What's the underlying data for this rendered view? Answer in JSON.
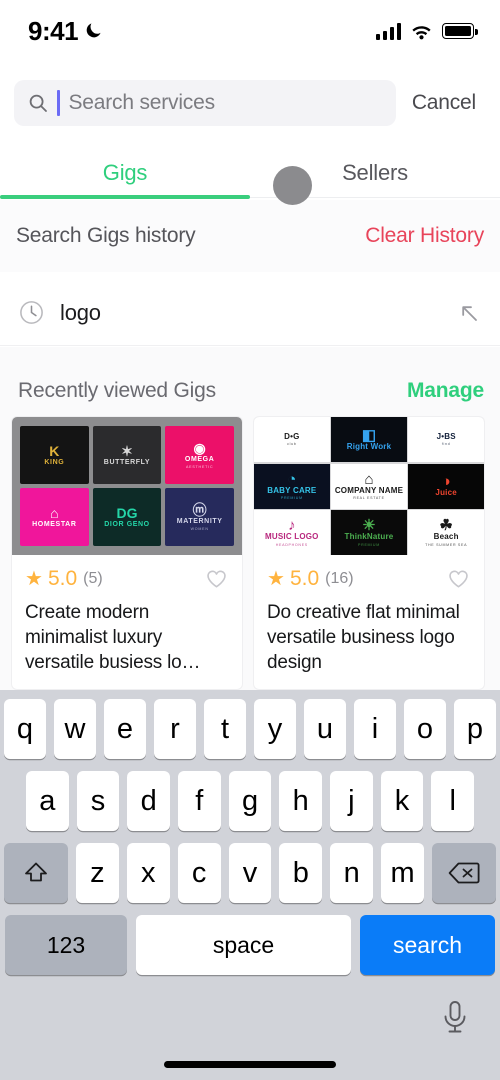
{
  "status_bar": {
    "time": "9:41",
    "dnd_icon": "crescent-moon-icon",
    "signal_icon": "cellular-signal-icon",
    "wifi_icon": "wifi-icon",
    "battery_icon": "battery-full-icon"
  },
  "search": {
    "placeholder": "Search services",
    "value": "",
    "cancel_label": "Cancel",
    "icon": "search-icon"
  },
  "tabs": [
    {
      "label": "Gigs",
      "active": true
    },
    {
      "label": "Sellers",
      "active": false
    }
  ],
  "history": {
    "section_title": "Search Gigs history",
    "clear_label": "Clear History",
    "items": [
      {
        "text": "logo",
        "leading_icon": "clock-icon",
        "trailing_icon": "arrow-up-left-icon"
      }
    ]
  },
  "recent": {
    "title": "Recently viewed Gigs",
    "manage_label": "Manage",
    "cards": [
      {
        "rating": "5.0",
        "reviews": "(5)",
        "title": "Create modern minimalist luxury versatile busiess lo…",
        "favorited": false,
        "thumbnail_style": "grid-6",
        "tiles": [
          {
            "name": "KING",
            "sub": "",
            "mark": "K",
            "bg": "#141414",
            "fg": "#e0b23a"
          },
          {
            "name": "BUTTERFLY",
            "sub": "",
            "mark": "✶",
            "bg": "#2b2b2d",
            "fg": "#d8d8d8"
          },
          {
            "name": "OMEGA",
            "sub": "AESTHETIC",
            "mark": "◉",
            "bg": "#ec1069",
            "fg": "#ffffff"
          },
          {
            "name": "HOMESTAR",
            "sub": "",
            "mark": "⌂",
            "bg": "#f0169b",
            "fg": "#ffffff"
          },
          {
            "name": "DIOR GENO",
            "sub": "",
            "mark": "DG",
            "bg": "#0d2b27",
            "fg": "#24d6a8"
          },
          {
            "name": "MATERNITY",
            "sub": "WOMEN",
            "mark": "ⓜ",
            "bg": "#262a5c",
            "fg": "#d5d7ea"
          }
        ]
      },
      {
        "rating": "5.0",
        "reviews": "(16)",
        "title": "Do creative flat minimal versatile business logo design",
        "favorited": false,
        "thumbnail_style": "grid-9",
        "tiles": [
          {
            "name": "D•G",
            "sub": "club",
            "mark": "",
            "bg": "#ffffff",
            "fg": "#1a1a1a"
          },
          {
            "name": "Right Work",
            "sub": "",
            "mark": "◧",
            "bg": "#080c12",
            "fg": "#35a3ef"
          },
          {
            "name": "J•BS",
            "sub": "find",
            "mark": "",
            "bg": "#ffffff",
            "fg": "#12203a"
          },
          {
            "name": "BABY CARE",
            "sub": "PREMIUM",
            "mark": "◔",
            "bg": "#0a1020",
            "fg": "#35c4e8"
          },
          {
            "name": "COMPANY NAME",
            "sub": "REAL ESTATE",
            "mark": "⌂",
            "bg": "#ffffff",
            "fg": "#1a1a1a"
          },
          {
            "name": "Juice",
            "sub": "",
            "mark": "◑",
            "bg": "#060606",
            "fg": "#f0452f"
          },
          {
            "name": "MUSIC LOGO",
            "sub": "HEADPHONES",
            "mark": "♪",
            "bg": "#ffffff",
            "fg": "#b8267d"
          },
          {
            "name": "ThinkNature",
            "sub": "PREMIUM",
            "mark": "☀",
            "bg": "#0a0a0a",
            "fg": "#4caf50"
          },
          {
            "name": "Beach",
            "sub": "THE SUMMER SEA",
            "mark": "☘",
            "bg": "#ffffff",
            "fg": "#1a1a1a"
          }
        ]
      }
    ]
  },
  "keyboard": {
    "row1": [
      "q",
      "w",
      "e",
      "r",
      "t",
      "y",
      "u",
      "i",
      "o",
      "p"
    ],
    "row2": [
      "a",
      "s",
      "d",
      "f",
      "g",
      "h",
      "j",
      "k",
      "l"
    ],
    "row3": [
      "z",
      "x",
      "c",
      "v",
      "b",
      "n",
      "m"
    ],
    "shift_icon": "shift-arrow-icon",
    "backspace_icon": "backspace-icon",
    "numeric_label": "123",
    "space_label": "space",
    "action_label": "search",
    "dictation_icon": "microphone-icon"
  },
  "colors": {
    "accent_green": "#2fcf7d",
    "destructive_red": "#e8445a",
    "star_amber": "#ffb33e",
    "action_blue": "#0a7cf8",
    "keyboard_bg": "#d1d3d9"
  }
}
